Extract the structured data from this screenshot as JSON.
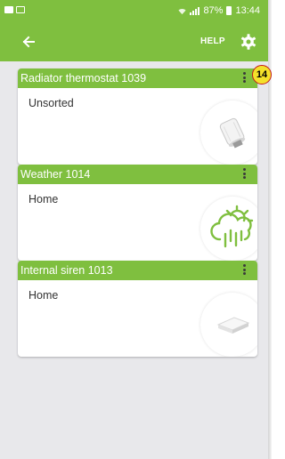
{
  "status_bar": {
    "battery_percent": "87%",
    "time": "13:44"
  },
  "app_bar": {
    "help_label": "HELP"
  },
  "devices": [
    {
      "title": "Radiator thermostat 1039",
      "location": "Unsorted",
      "icon": "radiator-thermostat-icon"
    },
    {
      "title": "Weather 1014",
      "location": "Home",
      "icon": "weather-icon"
    },
    {
      "title": "Internal siren 1013",
      "location": "Home",
      "icon": "siren-icon"
    }
  ],
  "badge": {
    "value": "14"
  },
  "colors": {
    "accent": "#7fbf3f",
    "background": "#e8e8eb",
    "badge_fill": "#f4e12a",
    "badge_border": "#c21a1a"
  }
}
